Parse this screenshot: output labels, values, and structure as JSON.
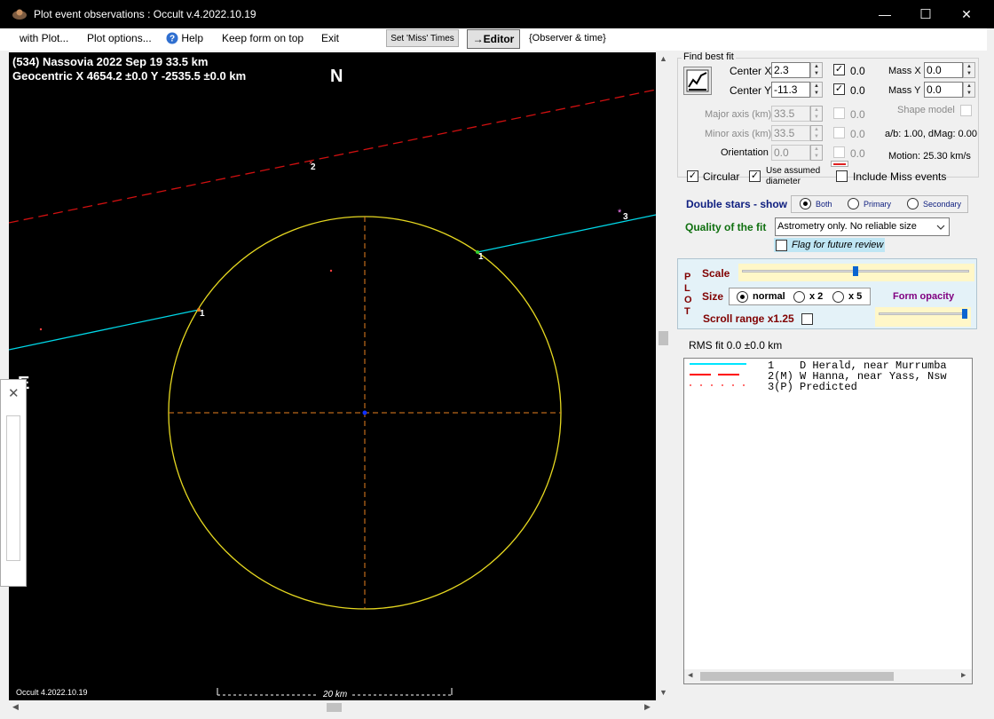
{
  "window": {
    "title": "Plot event observations : Occult v.4.2022.10.19",
    "min_glyph": "—",
    "max_glyph": "☐",
    "close_glyph": "✕"
  },
  "menu": {
    "with_plot": "with Plot...",
    "plot_options": "Plot options...",
    "help": "Help",
    "keep_on_top": "Keep form on top",
    "exit": "Exit",
    "set_miss_times": "Set 'Miss' Times",
    "editor": "→Editor",
    "observer_time": "{Observer & time}"
  },
  "plot": {
    "header_line1": "(534) Nassovia  2022 Sep 19   33.5 km",
    "header_line2": "Geocentric  X  4654.2 ±0.0  Y -2535.5 ±0.0 km",
    "north": "N",
    "east": "E",
    "version": "Occult 4.2022.10.19",
    "scale_bar": "20 km",
    "chord_labels": [
      "1",
      "1",
      "2",
      "3"
    ]
  },
  "fit": {
    "group_title": "Find best fit",
    "center_x_label": "Center X",
    "center_x": "2.3",
    "center_x_check_value": "0.0",
    "center_y_label": "Center Y",
    "center_y": "-11.3",
    "center_y_check_value": "0.0",
    "mass_x_label": "Mass X",
    "mass_x": "0.0",
    "mass_y_label": "Mass Y",
    "mass_y": "0.0",
    "shape_model": "Shape model",
    "major_label": "Major axis (km)",
    "major": "33.5",
    "major_check_value": "0.0",
    "minor_label": "Minor axis (km)",
    "minor": "33.5",
    "minor_check_value": "0.0",
    "orient_label": "Orientation",
    "orient": "0.0",
    "orient_check_value": "0.0",
    "ab_dmag": "a/b: 1.00, dMag: 0.00",
    "motion": "Motion: 25.30 km/s",
    "circular": "Circular",
    "use_assumed_1": "Use assumed",
    "use_assumed_2": "diameter",
    "include_miss": "Include Miss events"
  },
  "double_stars": {
    "label": "Double stars - show",
    "both": "Both",
    "primary": "Primary",
    "secondary": "Secondary"
  },
  "quality": {
    "label": "Quality of the fit",
    "value": "Astrometry only. No reliable size",
    "flag": "Flag for future review"
  },
  "plotbox": {
    "side": [
      "P",
      "L",
      "O",
      "T"
    ],
    "scale": "Scale",
    "size": "Size",
    "normal": "normal",
    "x2": "x 2",
    "x5": "x 5",
    "form_opacity": "Form opacity",
    "scroll_range": "Scroll range x1.25",
    "scale_level": 0.5,
    "opacity_level": 1.0
  },
  "rms": "RMS fit 0.0 ±0.0 km",
  "legend": [
    {
      "text": "1    D Herald, near Murrumba",
      "color": "#00e5ff",
      "style": "solid"
    },
    {
      "text": "2(M) W Hanna, near Yass, Nsw",
      "color": "#ff0000",
      "style": "dashed"
    },
    {
      "text": "3(P) Predicted",
      "color": "#ff7070",
      "style": "dotted"
    }
  ],
  "colors": {
    "miss_chord": "#d01010",
    "hit_chord": "#00d8e8",
    "ellipse": "#e6d820",
    "axis": "#e88020",
    "center": "#1030ff"
  }
}
